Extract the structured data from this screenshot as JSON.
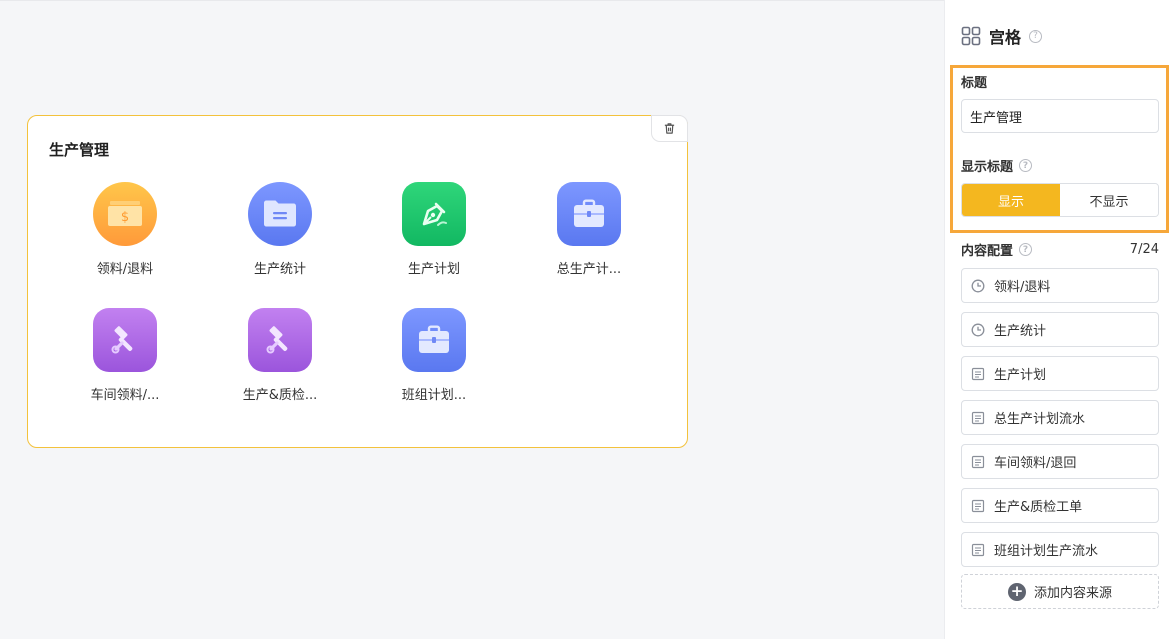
{
  "card": {
    "title": "生产管理",
    "items": [
      {
        "label": "领料/退料",
        "icon": "money-card-icon"
      },
      {
        "label": "生产统计",
        "icon": "folder-icon"
      },
      {
        "label": "生产计划",
        "icon": "pen-nib-icon"
      },
      {
        "label": "总生产计...",
        "icon": "toolbox-icon"
      },
      {
        "label": "车间领料/...",
        "icon": "hammer-wrench-icon"
      },
      {
        "label": "生产&质检...",
        "icon": "hammer-wrench-icon"
      },
      {
        "label": "班组计划...",
        "icon": "toolbox-icon"
      }
    ]
  },
  "panel": {
    "header": "宫格",
    "title_label": "标题",
    "title_value": "生产管理",
    "show_title_label": "显示标题",
    "show_option": "显示",
    "hide_option": "不显示",
    "content_label": "内容配置",
    "content_count": "7/24",
    "sources": [
      {
        "label": "领料/退料",
        "icon": "clock-icon"
      },
      {
        "label": "生产统计",
        "icon": "clock-icon"
      },
      {
        "label": "生产计划",
        "icon": "document-icon"
      },
      {
        "label": "总生产计划流水",
        "icon": "document-icon"
      },
      {
        "label": "车间领料/退回",
        "icon": "document-icon"
      },
      {
        "label": "生产&质检工单",
        "icon": "document-icon"
      },
      {
        "label": "班组计划生产流水",
        "icon": "document-icon"
      }
    ],
    "add_source": "添加内容来源"
  },
  "colors": {
    "accent": "#f4b71f",
    "highlight_border": "#f6a73a",
    "card_border": "#f3c23c"
  }
}
